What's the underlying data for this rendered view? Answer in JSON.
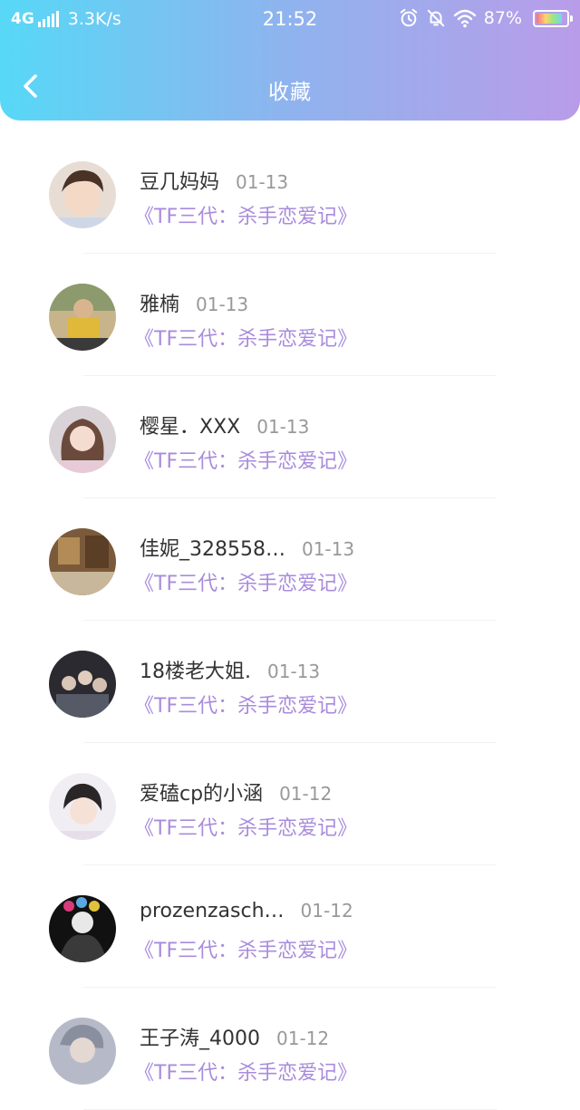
{
  "status_bar": {
    "network": "4G",
    "speed": "3.3K/s",
    "time": "21:52",
    "battery": "87%",
    "battery_level": 0.87,
    "icons": [
      "alarm-icon",
      "bell-off-icon",
      "wifi-icon",
      "battery-icon"
    ]
  },
  "header": {
    "title": "收藏",
    "back_icon": "chevron-left-icon"
  },
  "favorites": [
    {
      "name": "豆几妈妈",
      "date": "01-13",
      "work": "《TF三代：杀手恋爱记》"
    },
    {
      "name": "雅楠",
      "date": "01-13",
      "work": "《TF三代：杀手恋爱记》"
    },
    {
      "name": "樱星．XXX",
      "date": "01-13",
      "work": "《TF三代：杀手恋爱记》"
    },
    {
      "name": "佳妮_328558…",
      "date": "01-13",
      "work": "《TF三代：杀手恋爱记》"
    },
    {
      "name": "18楼老大姐.",
      "date": "01-13",
      "work": "《TF三代：杀手恋爱记》"
    },
    {
      "name": "爱磕cp的小涵",
      "date": "01-12",
      "work": "《TF三代：杀手恋爱记》"
    },
    {
      "name": "prozenzasch…",
      "date": "01-12",
      "work": "《TF三代：杀手恋爱记》"
    },
    {
      "name": "王子涛_4000",
      "date": "01-12",
      "work": "《TF三代：杀手恋爱记》"
    }
  ],
  "colors": {
    "header_gradient_start": "#57d8f6",
    "header_gradient_end": "#b99ce9",
    "work_title": "#a98bdc",
    "date": "#999999"
  }
}
